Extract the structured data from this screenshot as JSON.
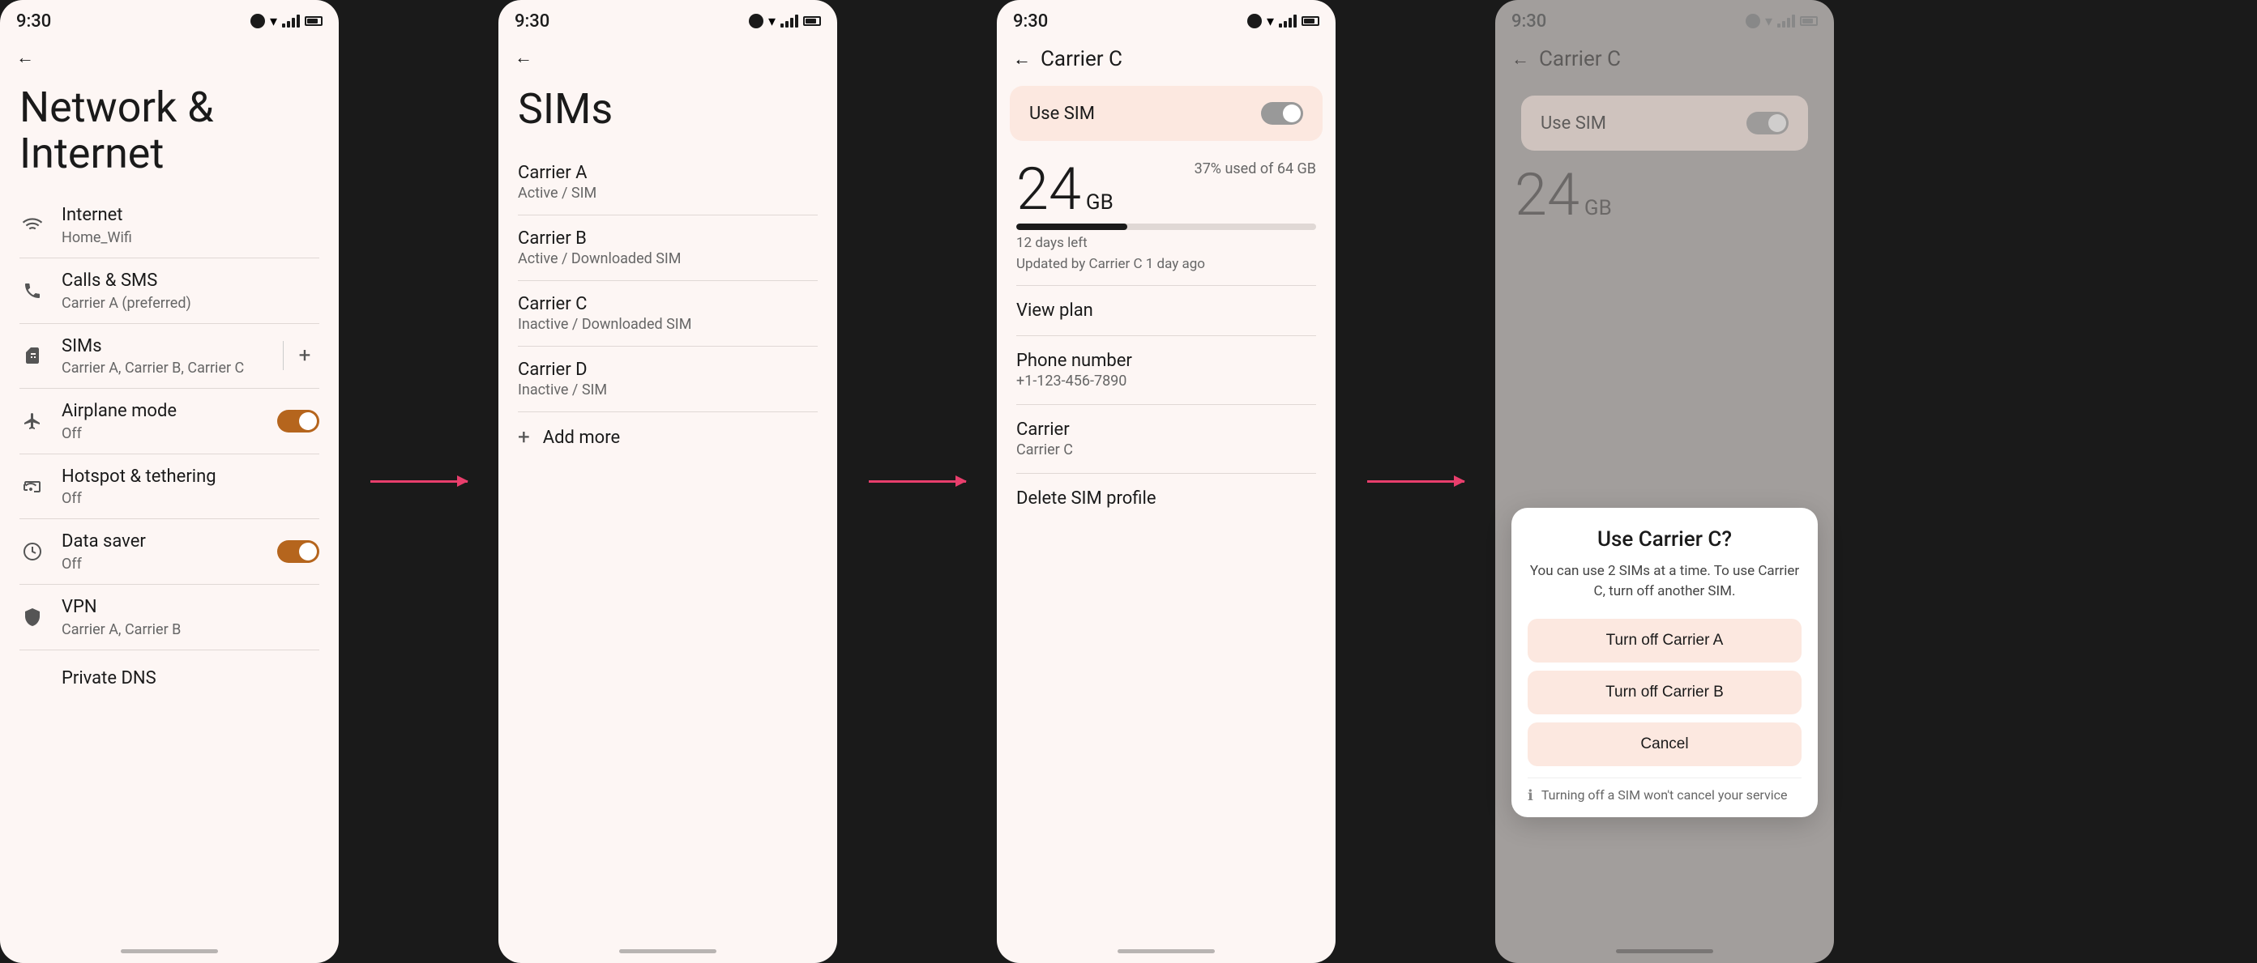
{
  "panels": {
    "p1": {
      "status_time": "9:30",
      "title": "Network & Internet",
      "items": [
        {
          "id": "internet",
          "icon": "wifi",
          "label": "Internet",
          "subtitle": "Home_Wifi"
        },
        {
          "id": "calls",
          "icon": "phone",
          "label": "Calls & SMS",
          "subtitle": "Carrier A (preferred)"
        },
        {
          "id": "sims",
          "icon": "sim",
          "label": "SIMs",
          "subtitle": "Carrier A, Carrier B, Carrier C"
        },
        {
          "id": "airplane",
          "icon": "plane",
          "label": "Airplane mode",
          "subtitle": "Off",
          "toggle": true,
          "toggle_state": "on"
        },
        {
          "id": "hotspot",
          "icon": "hotspot",
          "label": "Hotspot & tethering",
          "subtitle": "Off"
        },
        {
          "id": "datasaver",
          "icon": "datasaver",
          "label": "Data saver",
          "subtitle": "Off",
          "toggle": true,
          "toggle_state": "on"
        },
        {
          "id": "vpn",
          "icon": "vpn",
          "label": "VPN",
          "subtitle": "Carrier A, Carrier B"
        }
      ],
      "private_dns": "Private DNS"
    },
    "p2": {
      "status_time": "9:30",
      "title": "SIMs",
      "carriers": [
        {
          "id": "carrier-a",
          "name": "Carrier A",
          "status": "Active / SIM"
        },
        {
          "id": "carrier-b",
          "name": "Carrier B",
          "status": "Active / Downloaded SIM"
        },
        {
          "id": "carrier-c",
          "name": "Carrier C",
          "status": "Inactive / Downloaded SIM",
          "highlighted": true
        },
        {
          "id": "carrier-d",
          "name": "Carrier D",
          "status": "Inactive / SIM"
        }
      ],
      "add_more": "Add more"
    },
    "p3": {
      "status_time": "9:30",
      "back_label": "Carrier C",
      "use_sim_label": "Use SIM",
      "data_number": "24",
      "data_unit": "GB",
      "data_percent": "37% used of 64 GB",
      "data_progress": 37,
      "days_left": "12 days left",
      "updated": "Updated by Carrier C 1 day ago",
      "items": [
        {
          "id": "view-plan",
          "label": "View plan",
          "subtitle": ""
        },
        {
          "id": "phone-number",
          "label": "Phone number",
          "subtitle": "+1-123-456-7890"
        },
        {
          "id": "carrier",
          "label": "Carrier",
          "subtitle": "Carrier C"
        },
        {
          "id": "delete-sim",
          "label": "Delete SIM profile",
          "subtitle": ""
        }
      ]
    },
    "p4": {
      "status_time": "9:30",
      "back_label": "Carrier C",
      "use_sim_label": "Use SIM",
      "dialog": {
        "title": "Use Carrier C?",
        "body": "You can use 2 SIMs at a time. To use Carrier C, turn off another SIM.",
        "btn1": "Turn off Carrier A",
        "btn2": "Turn off Carrier B",
        "btn3": "Cancel",
        "footer": "Turning off a SIM won't cancel your service"
      }
    }
  },
  "arrows": {
    "arrow1_label": "→",
    "arrow2_label": "→",
    "arrow3_label": "→"
  }
}
